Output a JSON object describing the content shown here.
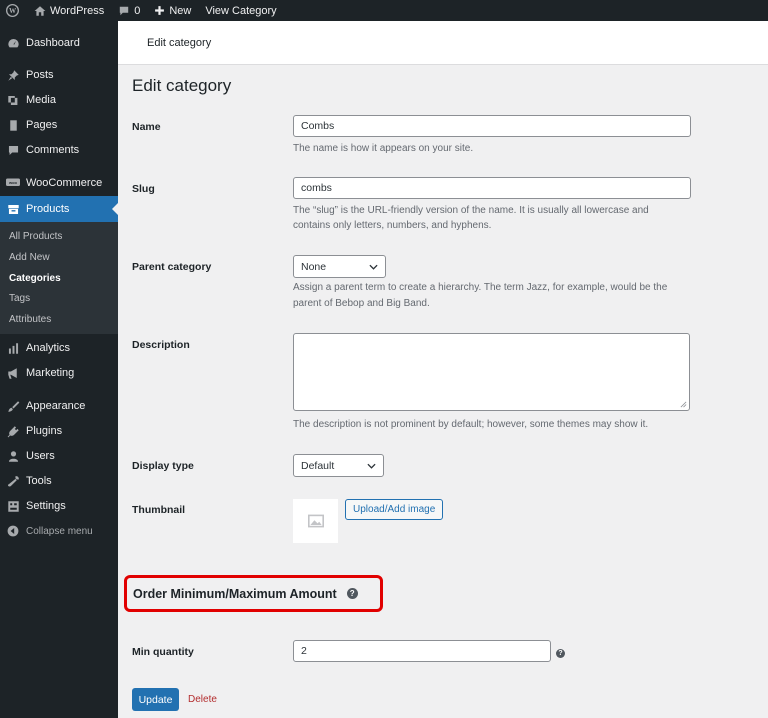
{
  "adminbar": {
    "site_name": "WordPress",
    "comments_count": "0",
    "new_label": "New",
    "view_label": "View Category"
  },
  "sidebar": {
    "items": [
      {
        "label": "Dashboard",
        "icon": "dashboard-icon"
      },
      {
        "label": "Posts",
        "icon": "pin-icon"
      },
      {
        "label": "Media",
        "icon": "media-icon"
      },
      {
        "label": "Pages",
        "icon": "pages-icon"
      },
      {
        "label": "Comments",
        "icon": "comments-icon"
      },
      {
        "label": "WooCommerce",
        "icon": "woo-icon"
      },
      {
        "label": "Products",
        "icon": "products-icon"
      },
      {
        "label": "Analytics",
        "icon": "analytics-icon"
      },
      {
        "label": "Marketing",
        "icon": "megaphone-icon"
      },
      {
        "label": "Appearance",
        "icon": "brush-icon"
      },
      {
        "label": "Plugins",
        "icon": "plugin-icon"
      },
      {
        "label": "Users",
        "icon": "user-icon"
      },
      {
        "label": "Tools",
        "icon": "wrench-icon"
      },
      {
        "label": "Settings",
        "icon": "settings-icon"
      }
    ],
    "submenu": [
      "All Products",
      "Add New",
      "Categories",
      "Tags",
      "Attributes"
    ],
    "collapse_label": "Collapse menu"
  },
  "header": {
    "breadcrumb": "Edit category"
  },
  "main": {
    "title": "Edit category",
    "name_label": "Name",
    "name_value": "Combs",
    "name_help": "The name is how it appears on your site.",
    "slug_label": "Slug",
    "slug_value": "combs",
    "slug_help_1": "The “slug” is the URL-friendly version of the name. It is usually all lowercase and",
    "slug_help_2": "contains only letters, numbers, and hyphens.",
    "parent_label": "Parent category",
    "parent_value": "None",
    "parent_help_1": "Assign a parent term to create a hierarchy. The term Jazz, for example, would be the",
    "parent_help_2": "parent of Bebop and Big Band.",
    "description_label": "Description",
    "description_help": "The description is not prominent by default; however, some themes may show it.",
    "display_label": "Display type",
    "display_value": "Default",
    "thumbnail_label": "Thumbnail",
    "upload_label": "Upload/Add image",
    "section_title": "Order Minimum/Maximum Amount",
    "min_label": "Min quantity",
    "min_value": "2",
    "update_label": "Update",
    "delete_label": "Delete"
  },
  "colors": {
    "accent": "#2271b1",
    "sidebar_bg": "#1d2327",
    "highlight": "#e10000",
    "danger": "#b32d2e"
  }
}
